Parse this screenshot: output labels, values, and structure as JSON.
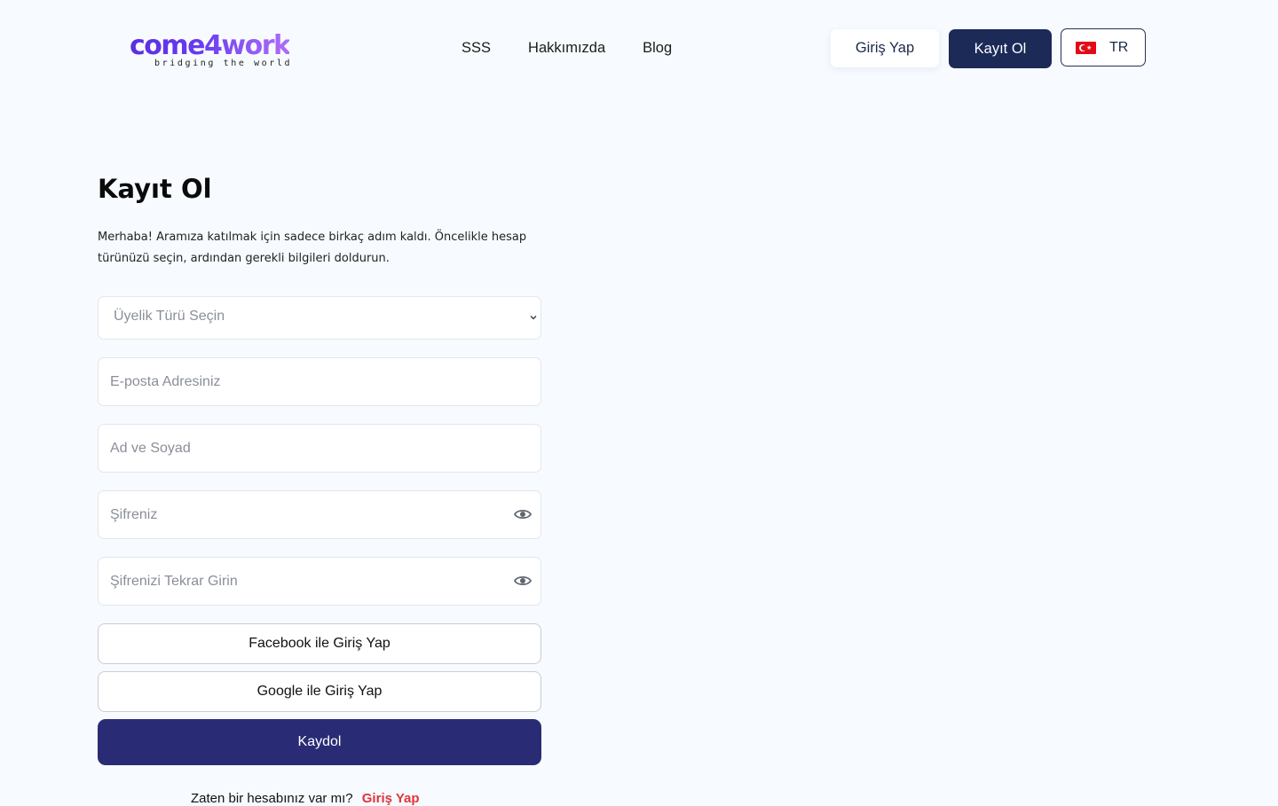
{
  "header": {
    "logo_text": "come4work",
    "logo_tagline": "bridging the world",
    "nav": [
      "SSS",
      "Hakkımızda",
      "Blog"
    ],
    "login_button": "Giriş Yap",
    "register_button": "Kayıt Ol",
    "language": "TR",
    "language_icon": "turkey-flag-icon"
  },
  "form": {
    "title": "Kayıt Ol",
    "intro": "Merhaba! Aramıza katılmak için sadece birkaç adım kaldı. Öncelikle hesap türünüzü seçin, ardından gerekli bilgileri doldurun.",
    "membership_select": "Üyelik Türü Seçin",
    "email_placeholder": "E-posta Adresiniz",
    "name_placeholder": "Ad ve Soyad",
    "password_placeholder": "Şifreniz",
    "password_confirm_placeholder": "Şifrenizi Tekrar Girin",
    "facebook_button": "Facebook ile Giriş Yap",
    "google_button": "Google ile Giriş Yap",
    "submit_button": "Kaydol",
    "have_account_text": "Zaten bir hesabınız var mı?",
    "login_link": "Giriş Yap"
  },
  "colors": {
    "primary_dark": "#1b2a57",
    "submit": "#292c74",
    "link_red": "#e0343a",
    "background": "#f7fbff"
  }
}
